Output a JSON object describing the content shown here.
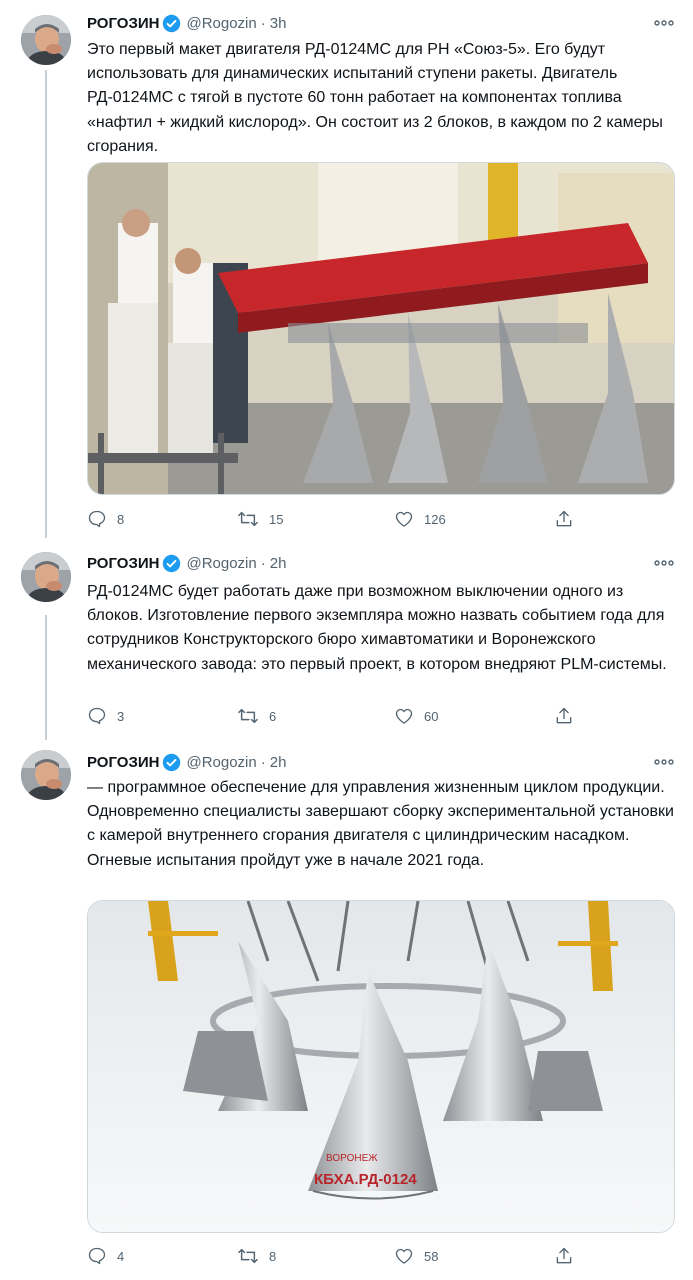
{
  "tweets": [
    {
      "name": "РОГОЗИН",
      "handle": "@Rogozin",
      "dot": "·",
      "time": "3h",
      "text": "Это первый макет двигателя РД-0124МС для РН «Союз-5». Его будут использовать для динамических испытаний ступени ракеты. Двигатель РД-0124МС с тягой в пустоте 60 тонн работает на компонентах топлива «нафтил + жидкий кислород». Он состоит из 2 блоков, в каждом по 2 камеры сгорания.",
      "replies": "8",
      "retweets": "15",
      "likes": "126"
    },
    {
      "name": "РОГОЗИН",
      "handle": "@Rogozin",
      "dot": "·",
      "time": "2h",
      "text": "РД-0124МС будет работать даже при возможном выключении одного из блоков. Изготовление первого экземпляра можно назвать событием года для сотрудников Конструкторского бюро химавтоматики и Воронежского механического завода: это первый проект, в котором внедряют PLM-системы.",
      "replies": "3",
      "retweets": "6",
      "likes": "60"
    },
    {
      "name": "РОГОЗИН",
      "handle": "@Rogozin",
      "dot": "·",
      "time": "2h",
      "text_p1": "— программное обеспечение для управления жизненным циклом продукции.",
      "text_p2": "Одновременно специалисты завершают сборку экспериментальной установки с камерой внутреннего сгорания двигателя с цилиндрическим насадком. Огневые испытания пройдут уже в начале 2021 года.",
      "image_text_1": "ВОРОНЕЖ",
      "image_text_2": "КБХА.РД-0124",
      "replies": "4",
      "retweets": "8",
      "likes": "58"
    }
  ],
  "colors": {
    "verified": "#1d9bf0",
    "secondary_text": "#536471",
    "thread_line": "#c4cfd6",
    "frame_red": "#c7262b"
  },
  "icons": [
    "verified-badge-icon",
    "more-icon",
    "reply-icon",
    "retweet-icon",
    "like-icon",
    "share-icon"
  ]
}
